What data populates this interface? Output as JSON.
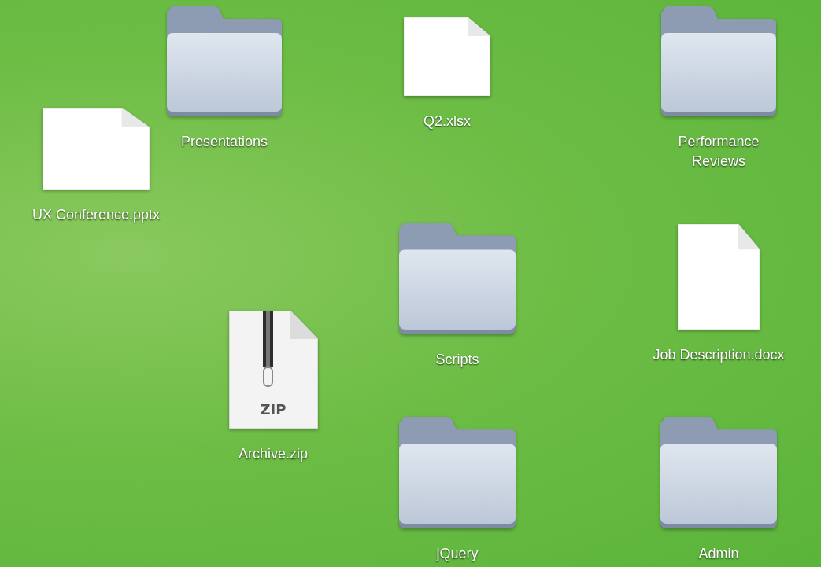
{
  "desktop_items": [
    {
      "kind": "document",
      "label": "UX Conference.pptx"
    },
    {
      "kind": "folder",
      "label": "Presentations"
    },
    {
      "kind": "document",
      "label": "Q2.xlsx"
    },
    {
      "kind": "folder",
      "label": "Performance Reviews"
    },
    {
      "kind": "folder",
      "label": "Scripts"
    },
    {
      "kind": "document",
      "label": "Job Description.docx"
    },
    {
      "kind": "archive",
      "label": "Archive.zip",
      "badge": "ZIP"
    },
    {
      "kind": "folder",
      "label": "jQuery"
    },
    {
      "kind": "folder",
      "label": "Admin"
    }
  ]
}
